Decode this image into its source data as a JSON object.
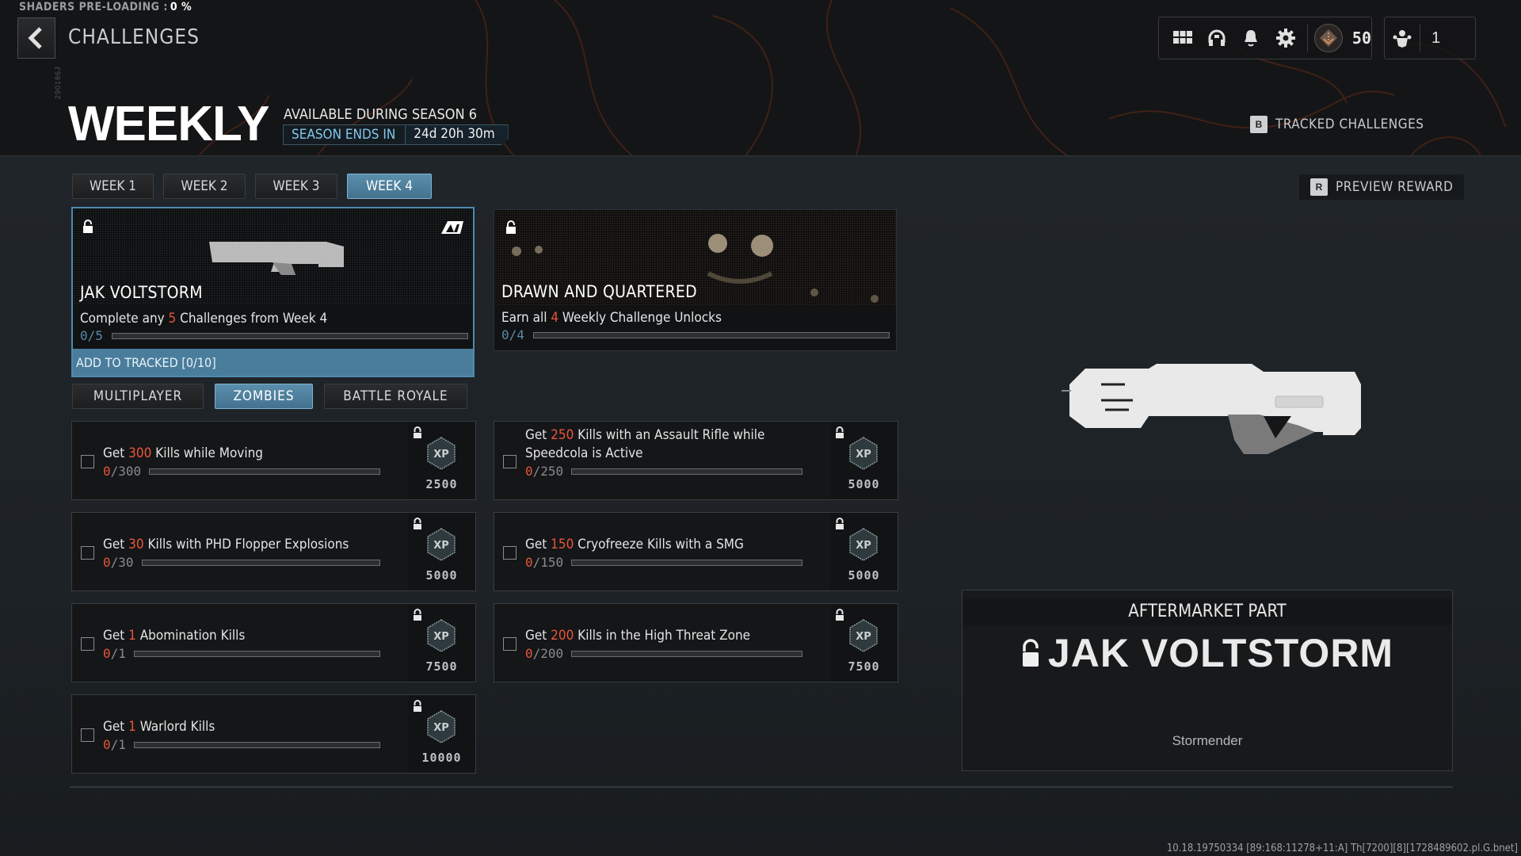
{
  "status": {
    "shaders_label": "SHADERS PRE-LOADING :",
    "shaders_value": "0 %"
  },
  "header": {
    "breadcrumb": "CHALLENGES",
    "title": "WEEKLY",
    "vertical_id": "290186J",
    "availability": "AVAILABLE DURING SEASON 6",
    "season_ends_label": "SEASON ENDS IN",
    "season_ends_value": "24d 20h 30m"
  },
  "top_bar": {
    "icons": [
      "grid-menu-icon",
      "headset-icon",
      "bell-icon",
      "gear-icon"
    ],
    "rank_level": "50",
    "party_count": "1"
  },
  "actions": {
    "tracked": {
      "key": "B",
      "label": "TRACKED CHALLENGES"
    },
    "preview": {
      "key": "R",
      "label": "PREVIEW REWARD"
    }
  },
  "week_tabs": [
    {
      "label": "WEEK 1",
      "active": false
    },
    {
      "label": "WEEK 2",
      "active": false
    },
    {
      "label": "WEEK 3",
      "active": false
    },
    {
      "label": "WEEK 4",
      "active": true
    }
  ],
  "featured": [
    {
      "title": "JAK VOLTSTORM",
      "desc_pre": "Complete any ",
      "desc_hl": "5",
      "desc_post": " Challenges from Week 4",
      "progress_text": "0/5",
      "progress": 0,
      "track_label": "ADD TO TRACKED [0/10]",
      "selected": true
    },
    {
      "title": "DRAWN AND QUARTERED",
      "desc_pre": "Earn all ",
      "desc_hl": "4",
      "desc_post": " Weekly Challenge Unlocks",
      "progress_text": "0/4",
      "progress": 0,
      "selected": false
    }
  ],
  "mode_tabs": [
    {
      "label": "MULTIPLAYER",
      "active": false
    },
    {
      "label": "ZOMBIES",
      "active": true
    },
    {
      "label": "BATTLE ROYALE",
      "active": false
    }
  ],
  "challenges": [
    {
      "pre": "Get ",
      "hl": "300",
      "post": " Kills while Moving",
      "current": "0",
      "total": "/300",
      "progress": 0,
      "xp": "2500"
    },
    {
      "pre": "Get ",
      "hl": "250",
      "post": " Kills with an Assault Rifle while Speedcola is Active",
      "current": "0",
      "total": "/250",
      "progress": 0,
      "xp": "5000"
    },
    {
      "pre": "Get ",
      "hl": "30",
      "post": " Kills with PHD Flopper Explosions",
      "current": "0",
      "total": "/30",
      "progress": 0,
      "xp": "5000"
    },
    {
      "pre": "Get ",
      "hl": "150",
      "post": " Cryofreeze Kills with a SMG",
      "current": "0",
      "total": "/150",
      "progress": 0,
      "xp": "5000"
    },
    {
      "pre": "Get ",
      "hl": "1",
      "post": " Abomination Kills",
      "current": "0",
      "total": "/1",
      "progress": 0,
      "xp": "7500"
    },
    {
      "pre": "Get ",
      "hl": "200",
      "post": " Kills in the High Threat Zone",
      "current": "0",
      "total": "/200",
      "progress": 0,
      "xp": "7500"
    },
    {
      "pre": "Get ",
      "hl": "1",
      "post": " Warlord Kills",
      "current": "0",
      "total": "/1",
      "progress": 0,
      "xp": "10000"
    }
  ],
  "reward": {
    "type": "AFTERMARKET PART",
    "name": "JAK VOLTSTORM",
    "base_weapon": "Stormender"
  },
  "build_info": "10.18.19750334 [89:168:11278+11:A] Th[7200][8][1728489602.pl.G.bnet]",
  "colors": {
    "accent": "#4f8bb0",
    "highlight": "#e8553a",
    "background": "#1e2328"
  }
}
